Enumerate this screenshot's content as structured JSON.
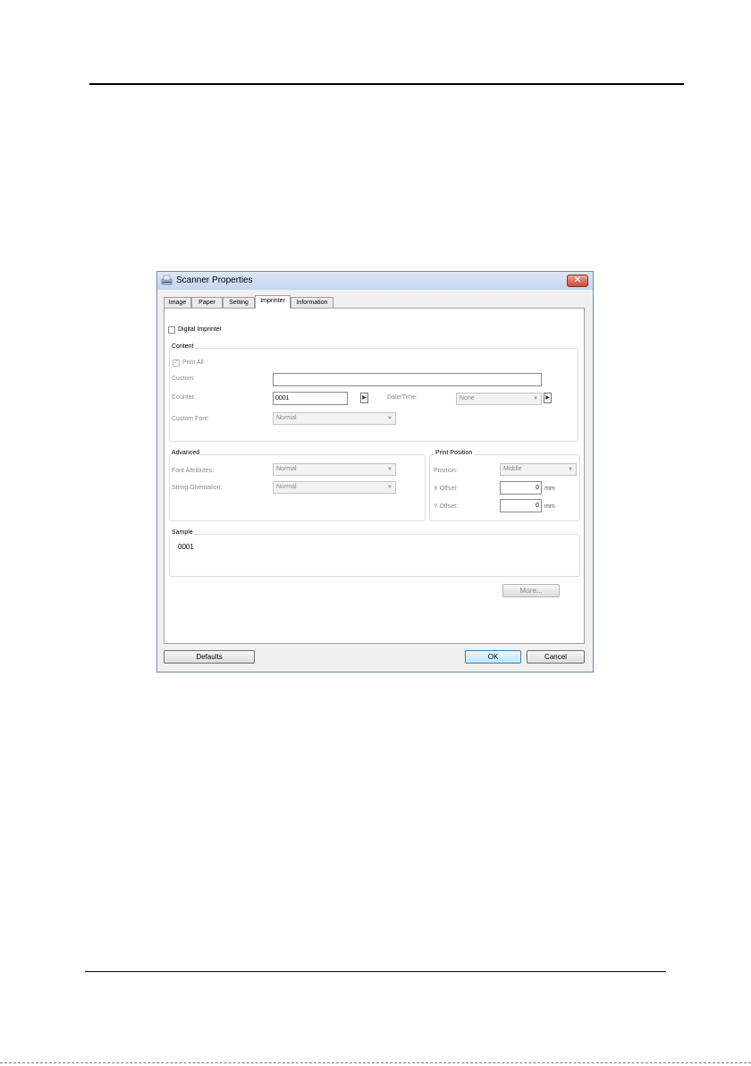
{
  "window": {
    "title": "Scanner Properties",
    "close_glyph": "✕"
  },
  "tabs": [
    {
      "label": "Image"
    },
    {
      "label": "Paper"
    },
    {
      "label": "Setting"
    },
    {
      "label": "Imprinter",
      "active": true
    },
    {
      "label": "Information"
    }
  ],
  "imprinter": {
    "digital_imprinter_label": "Digital Imprinter",
    "content": {
      "title": "Content",
      "print_all_label": "Print All",
      "custom_label": "Custom:",
      "custom_value": "",
      "counter_label": "Counter:",
      "counter_value": "0001",
      "datetime_label": "Date/Time:",
      "datetime_value": "None",
      "custom_font_label": "Custom Font:",
      "custom_font_value": "Normal"
    },
    "advanced": {
      "title": "Advanced",
      "font_attributes_label": "Font Attributes:",
      "font_attributes_value": "Normal",
      "string_orientation_label": "String Orientation:",
      "string_orientation_value": "Normal"
    },
    "print_position": {
      "title": "Print Position",
      "position_label": "Position:",
      "position_value": "Middle",
      "x_offset_label": "X Offset:",
      "x_offset_value": "0",
      "y_offset_label": "Y Offset:",
      "y_offset_value": "0",
      "unit": "mm"
    },
    "sample": {
      "title": "Sample",
      "value": "0001"
    },
    "more_label": "More..."
  },
  "footer": {
    "defaults_label": "Defaults",
    "ok_label": "OK",
    "cancel_label": "Cancel"
  },
  "icons": {
    "arrow_right": "▶",
    "dropdown": "▼",
    "check": "✓"
  }
}
